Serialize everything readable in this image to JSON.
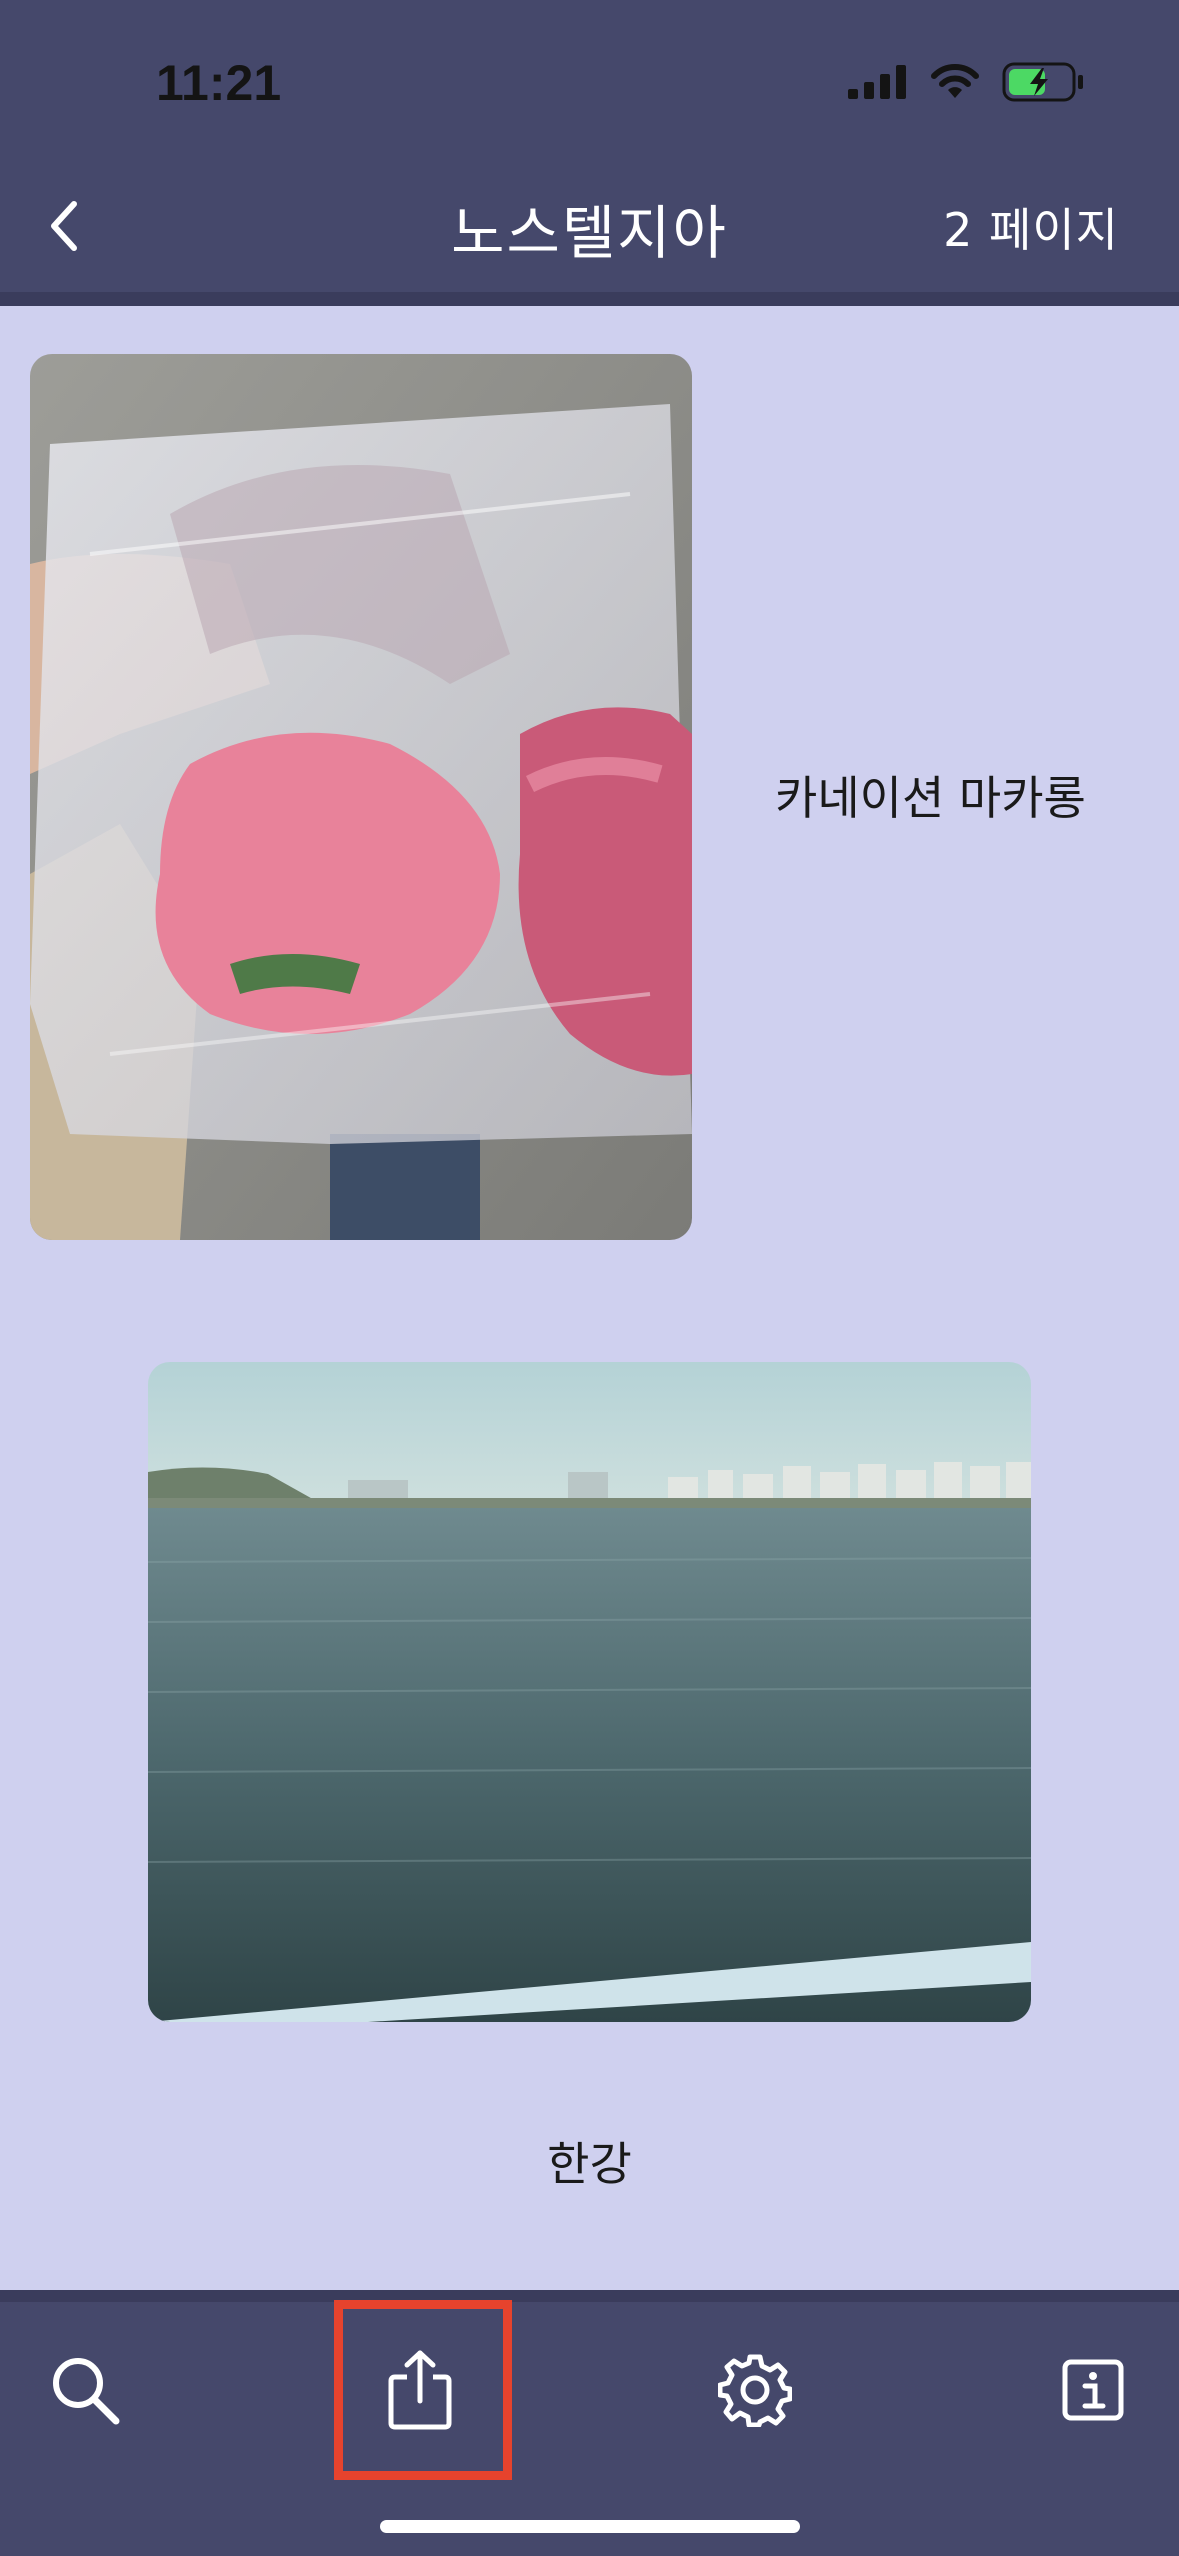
{
  "status_bar": {
    "time": "11:21"
  },
  "nav": {
    "title": "노스텔지아",
    "page_label": "2 페이지"
  },
  "entries": [
    {
      "caption": "카네이션 마카롱",
      "image": "photo-pink-macarons-in-plastic-bag"
    },
    {
      "caption": "한강",
      "image": "photo-han-river-view"
    }
  ],
  "tabbar": {
    "items": [
      "search-icon",
      "share-icon",
      "gear-icon",
      "info-icon"
    ]
  },
  "colors": {
    "header": "#45486b",
    "background": "#cfd0ef",
    "highlight": "#e6432d"
  }
}
